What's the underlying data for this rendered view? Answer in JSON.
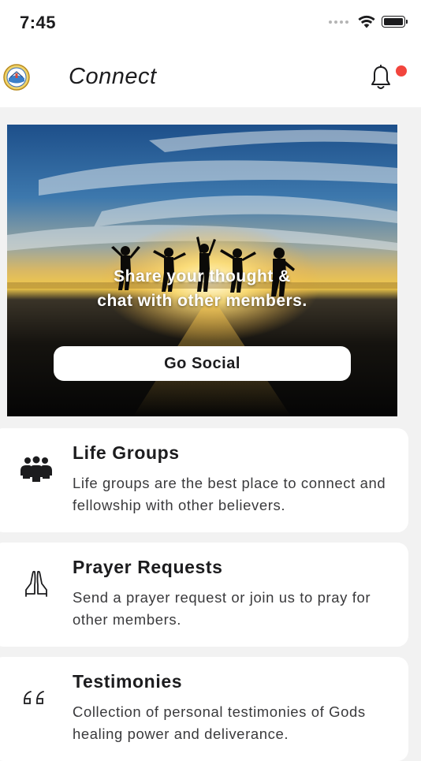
{
  "status_bar": {
    "time": "7:45"
  },
  "header": {
    "title": "Connect"
  },
  "hero": {
    "text_lines": [
      "Share your thought &",
      "chat with other members."
    ],
    "button_label": "Go Social"
  },
  "cards": [
    {
      "icon": "people-group-icon",
      "title": "Life Groups",
      "description": "Life groups are the best place to connect and fellowship with other believers."
    },
    {
      "icon": "praying-hands-icon",
      "title": "Prayer Requests",
      "description": "Send a prayer request or join us to pray for other members."
    },
    {
      "icon": "quote-icon",
      "title": "Testimonies",
      "description": "Collection of personal testimonies of Gods healing power and deliverance."
    }
  ],
  "colors": {
    "background": "#f2f2f2",
    "card": "#ffffff",
    "notification_dot": "#f2453d",
    "text": "#1c1c1e"
  }
}
